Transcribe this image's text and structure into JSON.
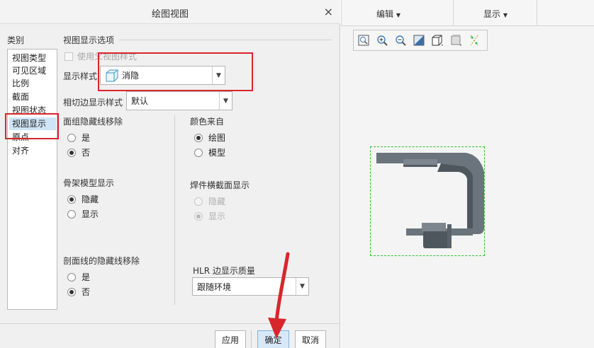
{
  "dialog": {
    "title": "绘图视图",
    "close_label": "×",
    "categories_label": "类别",
    "categories": [
      "视图类型",
      "可见区域",
      "比例",
      "截面",
      "视图状态",
      "视图显示",
      "原点",
      "对齐"
    ],
    "selected_category": "视图显示",
    "section_title": "视图显示选项",
    "use_parent_style": {
      "label": "使用父视图样式",
      "checked": false,
      "disabled": true
    },
    "display_style": {
      "label": "显示样式",
      "value": "消隐"
    },
    "tangent_edge": {
      "label": "相切边显示样式",
      "value": "默认"
    },
    "face_group_hidden": {
      "label": "面组隐藏线移除",
      "options": [
        "是",
        "否"
      ],
      "selected": "否"
    },
    "color_from": {
      "label": "颜色来自",
      "options": [
        "绘图",
        "模型"
      ],
      "selected": "绘图"
    },
    "skeleton_display": {
      "label": "骨架模型显示",
      "options": [
        "隐藏",
        "显示"
      ],
      "selected": "隐藏"
    },
    "weld_section_display": {
      "label": "焊件横截面显示",
      "options": [
        "隐藏",
        "显示"
      ],
      "selected": "显示",
      "disabled": true
    },
    "xsection_hidden": {
      "label": "剖面线的隐藏线移除",
      "options": [
        "是",
        "否"
      ],
      "selected": "否"
    },
    "hlr_quality": {
      "label": "HLR 边显示质量",
      "value": "跟随环境"
    },
    "buttons": {
      "apply": "应用",
      "ok": "确定",
      "cancel": "取消"
    }
  },
  "right_panel": {
    "menus": [
      "编辑",
      "显示"
    ],
    "toolbar_icons": [
      "zoom-fit-icon",
      "zoom-in-icon",
      "zoom-out-icon",
      "repaint-icon",
      "display-style-icon",
      "saved-views-icon",
      "datum-display-icon"
    ]
  },
  "colors": {
    "highlight_red": "#d9262c",
    "selection_blue": "#cfe4f6",
    "bbox_green": "#2fbf2f",
    "part_gray": "#5f6870"
  }
}
